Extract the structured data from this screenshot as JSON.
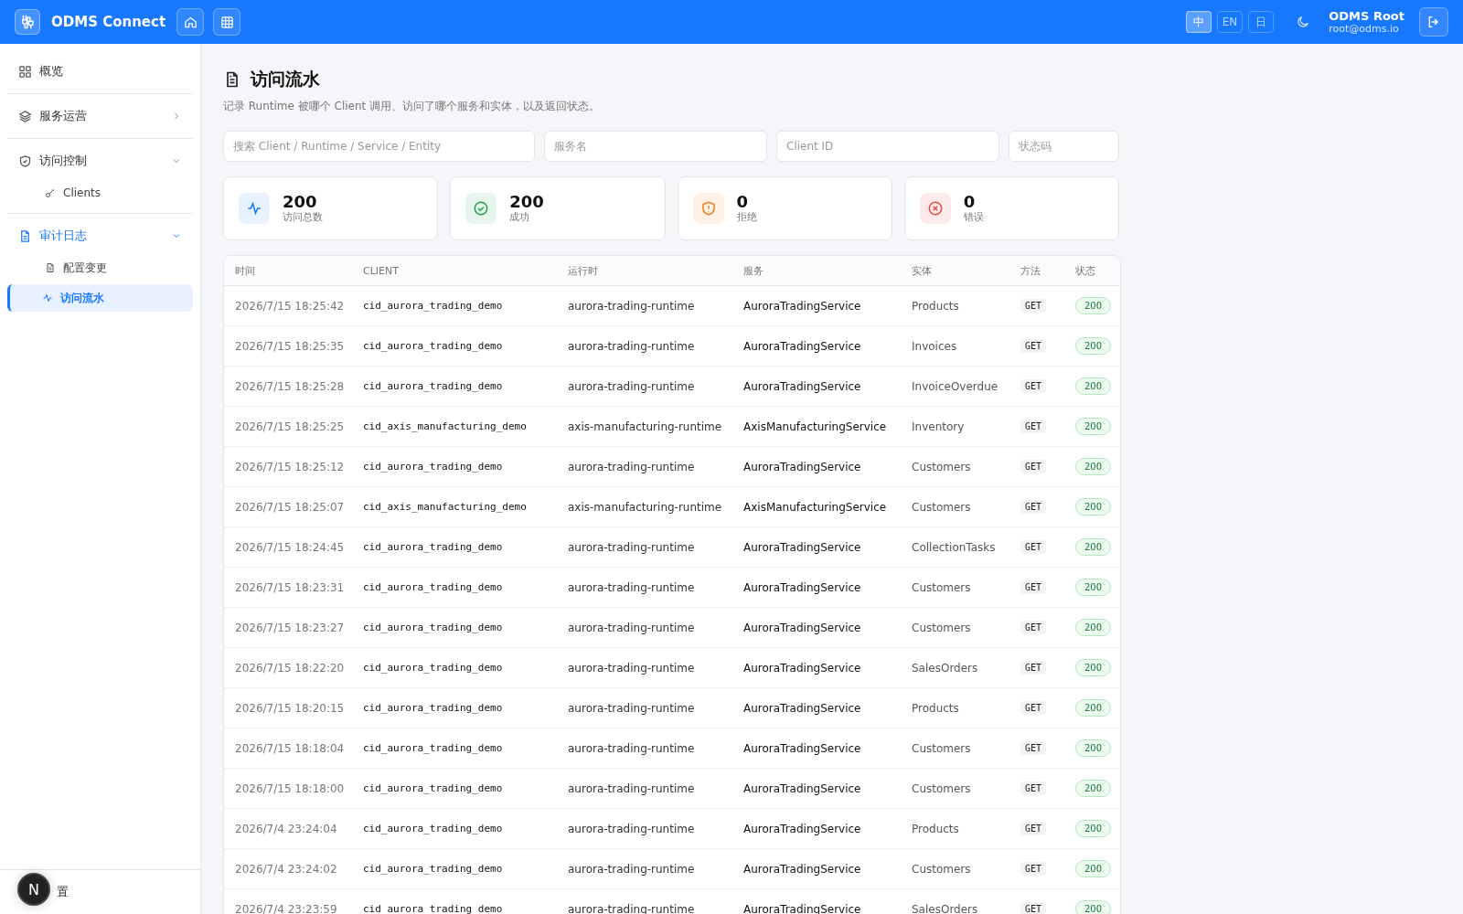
{
  "header": {
    "app_name": "ODMS Connect",
    "languages": [
      {
        "label": "中",
        "selected": true
      },
      {
        "label": "EN",
        "selected": false
      },
      {
        "label": "日",
        "selected": false
      }
    ],
    "user": {
      "name": "ODMS Root",
      "email": "root@odms.io"
    }
  },
  "sidebar": {
    "items": [
      {
        "label": "概览",
        "kind": "grid",
        "active": false
      },
      {
        "label": "服务运营",
        "kind": "layers",
        "expanded": false,
        "active": false
      },
      {
        "label": "访问控制",
        "kind": "shield",
        "expanded": true,
        "active": false,
        "children": [
          {
            "label": "Clients",
            "kind": "key",
            "selected": false
          }
        ]
      },
      {
        "label": "审计日志",
        "kind": "doc",
        "expanded": true,
        "active": true,
        "children": [
          {
            "label": "配置变更",
            "kind": "doc",
            "selected": false
          },
          {
            "label": "访问流水",
            "kind": "pulse",
            "selected": true
          }
        ]
      }
    ],
    "footer": {
      "label": "置"
    },
    "dev_badge": "N"
  },
  "page": {
    "title": "访问流水",
    "subtitle": "记录 Runtime 被哪个 Client 调用、访问了哪个服务和实体，以及返回状态。"
  },
  "filters": [
    {
      "placeholder": "搜索 Client / Runtime / Service / Entity"
    },
    {
      "placeholder": "服务名"
    },
    {
      "placeholder": "Client ID"
    },
    {
      "placeholder": "状态码"
    }
  ],
  "stats": [
    {
      "kind": "total",
      "value": "200",
      "label": "访问总数"
    },
    {
      "kind": "success",
      "value": "200",
      "label": "成功"
    },
    {
      "kind": "denied",
      "value": "0",
      "label": "拒绝"
    },
    {
      "kind": "error",
      "value": "0",
      "label": "错误"
    }
  ],
  "table": {
    "columns": [
      "时间",
      "CLIENT",
      "运行时",
      "服务",
      "实体",
      "方法",
      "状态"
    ],
    "rows": [
      [
        "2026/7/15 18:25:42",
        "cid_aurora_trading_demo",
        "aurora-trading-runtime",
        "AuroraTradingService",
        "Products",
        "GET",
        "200"
      ],
      [
        "2026/7/15 18:25:35",
        "cid_aurora_trading_demo",
        "aurora-trading-runtime",
        "AuroraTradingService",
        "Invoices",
        "GET",
        "200"
      ],
      [
        "2026/7/15 18:25:28",
        "cid_aurora_trading_demo",
        "aurora-trading-runtime",
        "AuroraTradingService",
        "InvoiceOverdue",
        "GET",
        "200"
      ],
      [
        "2026/7/15 18:25:25",
        "cid_axis_manufacturing_demo",
        "axis-manufacturing-runtime",
        "AxisManufacturingService",
        "Inventory",
        "GET",
        "200"
      ],
      [
        "2026/7/15 18:25:12",
        "cid_aurora_trading_demo",
        "aurora-trading-runtime",
        "AuroraTradingService",
        "Customers",
        "GET",
        "200"
      ],
      [
        "2026/7/15 18:25:07",
        "cid_axis_manufacturing_demo",
        "axis-manufacturing-runtime",
        "AxisManufacturingService",
        "Customers",
        "GET",
        "200"
      ],
      [
        "2026/7/15 18:24:45",
        "cid_aurora_trading_demo",
        "aurora-trading-runtime",
        "AuroraTradingService",
        "CollectionTasks",
        "GET",
        "200"
      ],
      [
        "2026/7/15 18:23:31",
        "cid_aurora_trading_demo",
        "aurora-trading-runtime",
        "AuroraTradingService",
        "Customers",
        "GET",
        "200"
      ],
      [
        "2026/7/15 18:23:27",
        "cid_aurora_trading_demo",
        "aurora-trading-runtime",
        "AuroraTradingService",
        "Customers",
        "GET",
        "200"
      ],
      [
        "2026/7/15 18:22:20",
        "cid_aurora_trading_demo",
        "aurora-trading-runtime",
        "AuroraTradingService",
        "SalesOrders",
        "GET",
        "200"
      ],
      [
        "2026/7/15 18:20:15",
        "cid_aurora_trading_demo",
        "aurora-trading-runtime",
        "AuroraTradingService",
        "Products",
        "GET",
        "200"
      ],
      [
        "2026/7/15 18:18:04",
        "cid_aurora_trading_demo",
        "aurora-trading-runtime",
        "AuroraTradingService",
        "Customers",
        "GET",
        "200"
      ],
      [
        "2026/7/15 18:18:00",
        "cid_aurora_trading_demo",
        "aurora-trading-runtime",
        "AuroraTradingService",
        "Customers",
        "GET",
        "200"
      ],
      [
        "2026/7/4 23:24:04",
        "cid_aurora_trading_demo",
        "aurora-trading-runtime",
        "AuroraTradingService",
        "Products",
        "GET",
        "200"
      ],
      [
        "2026/7/4 23:24:02",
        "cid_aurora_trading_demo",
        "aurora-trading-runtime",
        "AuroraTradingService",
        "Customers",
        "GET",
        "200"
      ],
      [
        "2026/7/4 23:23:59",
        "cid_aurora_trading_demo",
        "aurora-trading-runtime",
        "AuroraTradingService",
        "SalesOrders",
        "GET",
        "200"
      ]
    ]
  }
}
